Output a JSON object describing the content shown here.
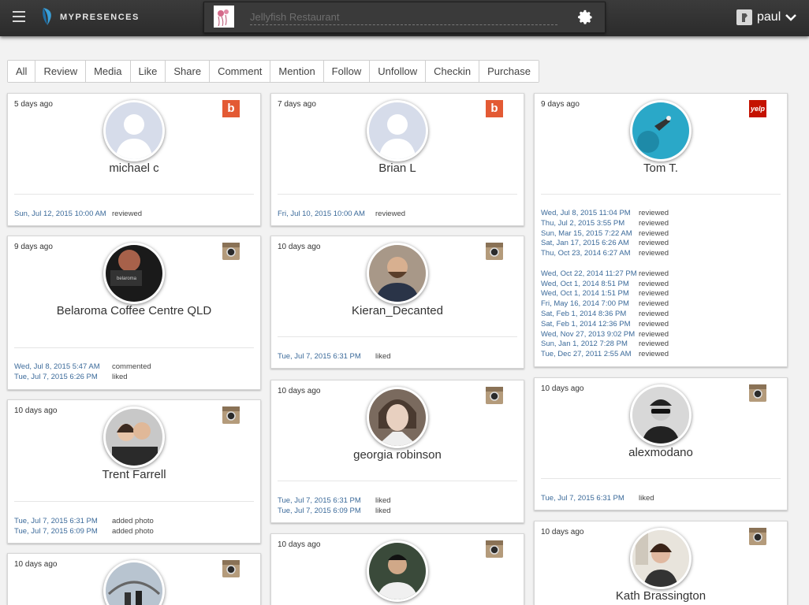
{
  "app": {
    "name": "MYPRESENCES"
  },
  "search": {
    "placeholder": "Jellyfish Restaurant"
  },
  "user": {
    "name": "paul"
  },
  "filters": [
    "All",
    "Review",
    "Media",
    "Like",
    "Share",
    "Comment",
    "Mention",
    "Follow",
    "Unfollow",
    "Checkin",
    "Purchase"
  ],
  "cards": [
    {
      "ago": "5 days ago",
      "name": "michael c",
      "source": "b",
      "acts": [
        {
          "date": "Sun, Jul 12, 2015 10:00 AM",
          "verb": "reviewed"
        }
      ]
    },
    {
      "ago": "9 days ago",
      "name": "Belaroma Coffee Centre QLD",
      "source": "instagram",
      "acts": [
        {
          "date": "Wed, Jul 8, 2015 5:47 AM",
          "verb": "commented"
        },
        {
          "date": "Tue, Jul 7, 2015 6:26 PM",
          "verb": "liked"
        }
      ]
    },
    {
      "ago": "10 days ago",
      "name": "Trent Farrell",
      "source": "instagram",
      "acts": [
        {
          "date": "Tue, Jul 7, 2015 6:31 PM",
          "verb": "added photo"
        },
        {
          "date": "Tue, Jul 7, 2015 6:09 PM",
          "verb": "added photo"
        }
      ]
    },
    {
      "ago": "10 days ago",
      "name": "",
      "source": "instagram",
      "acts": []
    },
    {
      "ago": "7 days ago",
      "name": "Brian L",
      "source": "b",
      "acts": [
        {
          "date": "Fri, Jul 10, 2015 10:00 AM",
          "verb": "reviewed"
        }
      ]
    },
    {
      "ago": "10 days ago",
      "name": "Kieran_Decanted",
      "source": "instagram",
      "acts": [
        {
          "date": "Tue, Jul 7, 2015 6:31 PM",
          "verb": "liked"
        }
      ]
    },
    {
      "ago": "10 days ago",
      "name": "georgia robinson",
      "source": "instagram",
      "acts": [
        {
          "date": "Tue, Jul 7, 2015 6:31 PM",
          "verb": "liked"
        },
        {
          "date": "Tue, Jul 7, 2015 6:09 PM",
          "verb": "liked"
        }
      ]
    },
    {
      "ago": "10 days ago",
      "name": "",
      "source": "instagram",
      "acts": []
    },
    {
      "ago": "9 days ago",
      "name": "Tom T.",
      "source": "yelp",
      "acts": [
        {
          "date": "Wed, Jul 8, 2015 11:04 PM",
          "verb": "reviewed"
        },
        {
          "date": "Thu, Jul 2, 2015 3:55 PM",
          "verb": "reviewed"
        },
        {
          "date": "Sun, Mar 15, 2015 7:22 AM",
          "verb": "reviewed"
        },
        {
          "date": "Sat, Jan 17, 2015 6:26 AM",
          "verb": "reviewed"
        },
        {
          "date": "Thu, Oct 23, 2014 6:27 AM",
          "verb": "reviewed"
        },
        {
          "date": "Wed, Oct 22, 2014 11:27 PM",
          "verb": "reviewed"
        },
        {
          "date": "Wed, Oct 1, 2014 8:51 PM",
          "verb": "reviewed"
        },
        {
          "date": "Wed, Oct 1, 2014 1:51 PM",
          "verb": "reviewed"
        },
        {
          "date": "Fri, May 16, 2014 7:00 PM",
          "verb": "reviewed"
        },
        {
          "date": "Sat, Feb 1, 2014 8:36 PM",
          "verb": "reviewed"
        },
        {
          "date": "Sat, Feb 1, 2014 12:36 PM",
          "verb": "reviewed"
        },
        {
          "date": "Wed, Nov 27, 2013 9:02 PM",
          "verb": "reviewed"
        },
        {
          "date": "Sun, Jan 1, 2012 7:28 PM",
          "verb": "reviewed"
        },
        {
          "date": "Tue, Dec 27, 2011 2:55 AM",
          "verb": "reviewed"
        }
      ]
    },
    {
      "ago": "10 days ago",
      "name": "alexmodano",
      "source": "instagram",
      "acts": [
        {
          "date": "Tue, Jul 7, 2015 6:31 PM",
          "verb": "liked"
        }
      ]
    },
    {
      "ago": "10 days ago",
      "name": "Kath Brassington",
      "source": "instagram",
      "acts": []
    }
  ]
}
